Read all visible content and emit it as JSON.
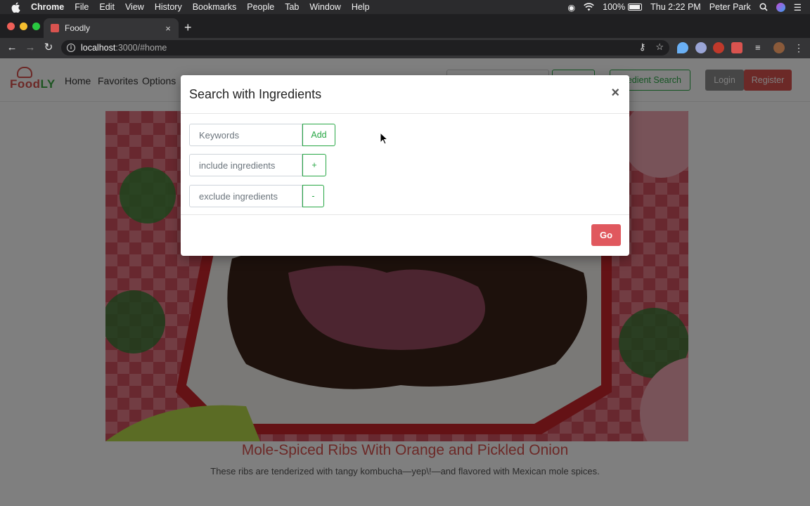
{
  "menubar": {
    "app": "Chrome",
    "items": [
      "File",
      "Edit",
      "View",
      "History",
      "Bookmarks",
      "People",
      "Tab",
      "Window",
      "Help"
    ],
    "battery": "100%",
    "clock": "Thu 2:22 PM",
    "user": "Peter Park"
  },
  "browser": {
    "tab_title": "Foodly",
    "tab_close": "×",
    "new_tab": "+",
    "url_host": "localhost",
    "url_path": ":3000/#home"
  },
  "site": {
    "nav": {
      "home": "Home",
      "favorites": "Favorites",
      "options": "Options",
      "ingredient_search": "redient Search",
      "login": "Login",
      "register": "Register"
    },
    "recipe": {
      "title": "Mole-Spiced Ribs With Orange and Pickled Onion",
      "description": "These ribs are tenderized with tangy kombucha—yep\\!—and flavored with Mexican mole spices."
    }
  },
  "modal": {
    "title": "Search with Ingredients",
    "close": "×",
    "keywords": {
      "placeholder": "Keywords",
      "button": "Add"
    },
    "include": {
      "placeholder": "include ingredients",
      "button": "+"
    },
    "exclude": {
      "placeholder": "exclude ingredients",
      "button": "-"
    },
    "go": "Go"
  },
  "colors": {
    "accent_red": "#d9534f",
    "accent_green": "#28a745",
    "go_button": "#e0585e"
  }
}
